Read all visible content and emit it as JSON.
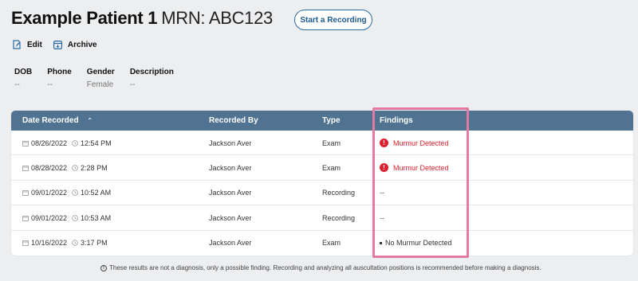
{
  "patient": {
    "name": "Example Patient 1",
    "mrn": "MRN: ABC123"
  },
  "buttons": {
    "start_recording": "Start a Recording",
    "edit": "Edit",
    "archive": "Archive"
  },
  "info": [
    {
      "label": "DOB",
      "value": "--"
    },
    {
      "label": "Phone",
      "value": "--"
    },
    {
      "label": "Gender",
      "value": "Female"
    },
    {
      "label": "Description",
      "value": "--"
    }
  ],
  "table": {
    "columns": {
      "date": "Date Recorded",
      "by": "Recorded By",
      "type": "Type",
      "findings": "Findings"
    },
    "rows": [
      {
        "date": "08/26/2022",
        "time": "12:54 PM",
        "by": "Jackson Aver",
        "type": "Exam",
        "finding": "Murmur Detected",
        "status": "alert"
      },
      {
        "date": "08/28/2022",
        "time": "2:28 PM",
        "by": "Jackson Aver",
        "type": "Exam",
        "finding": "Murmur Detected",
        "status": "alert"
      },
      {
        "date": "09/01/2022",
        "time": "10:52 AM",
        "by": "Jackson Aver",
        "type": "Recording",
        "finding": "--",
        "status": "none"
      },
      {
        "date": "09/01/2022",
        "time": "10:53 AM",
        "by": "Jackson Aver",
        "type": "Recording",
        "finding": "--",
        "status": "none"
      },
      {
        "date": "10/16/2022",
        "time": "3:17 PM",
        "by": "Jackson Aver",
        "type": "Exam",
        "finding": "No Murmur Detected",
        "status": "ok"
      }
    ]
  },
  "footer": {
    "note": "These results are not a diagnosis, only a possible finding. Recording and analyzing all auscultation positions is recommended before making a diagnosis."
  },
  "colors": {
    "header_bg": "#4f7390",
    "alert": "#e0202e",
    "highlight": "#e27aa4",
    "accent": "#2c6da5"
  }
}
